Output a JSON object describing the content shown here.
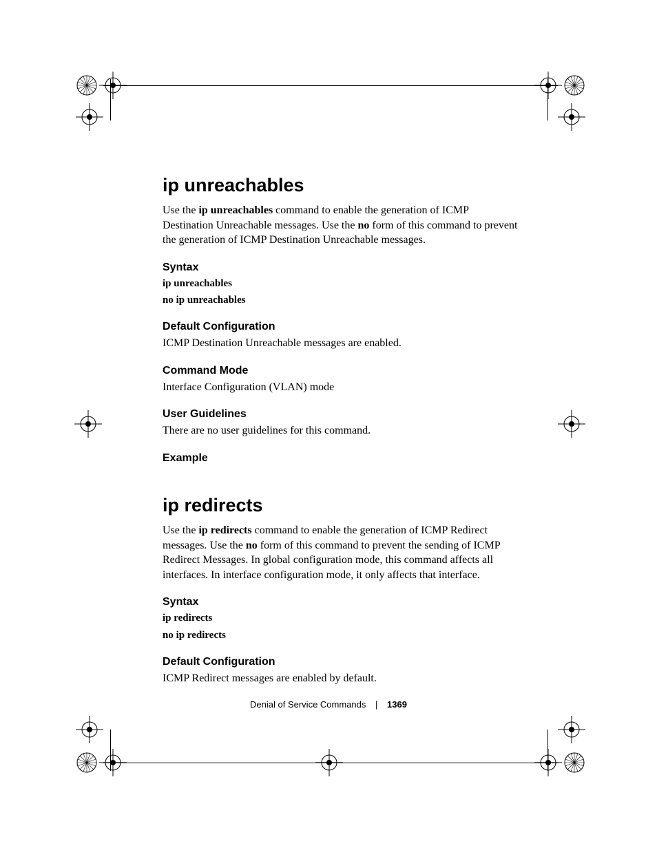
{
  "sec1": {
    "title": "ip unreachables",
    "intro_pre": "Use the ",
    "intro_cmd": "ip unreachables",
    "intro_mid": " command to enable the generation of ICMP Destination Unreachable messages. Use the ",
    "intro_no": "no",
    "intro_post": " form of this command to prevent the generation of ICMP Destination Unreachable messages.",
    "h_syntax": "Syntax",
    "syn1": "ip unreachables",
    "syn2": "no ip unreachables",
    "h_default": "Default Configuration",
    "default_text": "ICMP Destination Unreachable messages are enabled.",
    "h_mode": "Command Mode",
    "mode_text": "Interface Configuration (VLAN) mode",
    "h_guide": "User Guidelines",
    "guide_text": "There are no user guidelines for this command.",
    "h_example": "Example"
  },
  "sec2": {
    "title": "ip redirects",
    "intro_pre": "Use the ",
    "intro_cmd": "ip redirects",
    "intro_mid": " command to enable the generation of ICMP Redirect messages. Use the ",
    "intro_no": "no",
    "intro_post": " form of this command to prevent the sending of ICMP Redirect Messages. In global configuration mode, this command affects all interfaces. In interface configuration mode, it only affects that interface.",
    "h_syntax": "Syntax",
    "syn1": "ip redirects",
    "syn2": "no ip redirects",
    "h_default": "Default Configuration",
    "default_text": "ICMP Redirect messages are enabled by default."
  },
  "footer": {
    "section": "Denial of Service Commands",
    "page": "1369"
  }
}
